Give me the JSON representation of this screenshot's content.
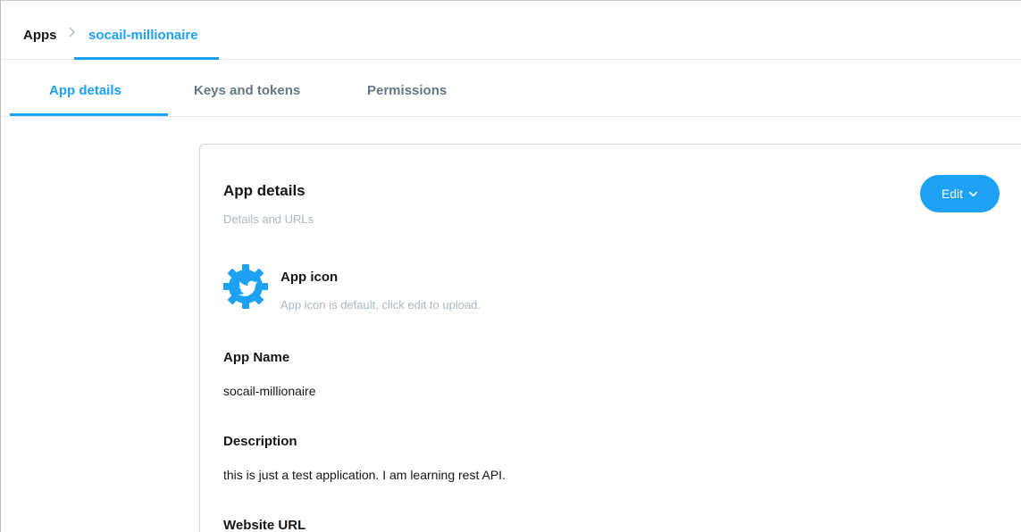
{
  "breadcrumb": {
    "root": "Apps",
    "current": "socail-millionaire"
  },
  "tabs": [
    {
      "label": "App details",
      "active": true
    },
    {
      "label": "Keys and tokens",
      "active": false
    },
    {
      "label": "Permissions",
      "active": false
    }
  ],
  "card": {
    "title": "App details",
    "subtitle": "Details and URLs",
    "edit_label": "Edit",
    "app_icon": {
      "label": "App icon",
      "hint": "App icon is default, click edit to upload."
    },
    "app_name": {
      "label": "App Name",
      "value": "socail-millionaire"
    },
    "description": {
      "label": "Description",
      "value": "this is just a test application. I am learning rest API."
    },
    "website_url": {
      "label": "Website URL"
    }
  },
  "colors": {
    "accent": "#1da1f2",
    "text": "#14171a",
    "muted": "#657786",
    "hint": "#aab8c2",
    "border": "#e1e8ed"
  },
  "icons": {
    "breadcrumb_separator": "chevron-right-icon",
    "edit_dropdown": "chevron-down-icon",
    "app_icon": "twitter-bird-gear-icon"
  }
}
